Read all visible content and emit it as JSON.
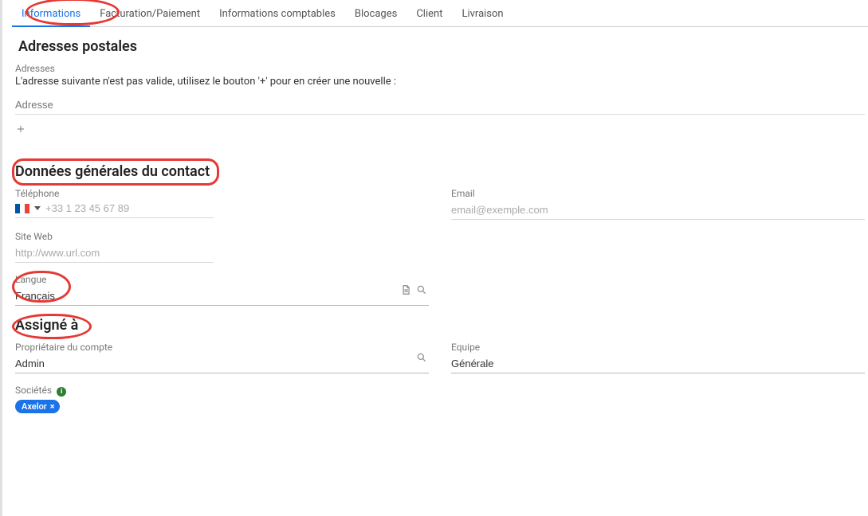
{
  "tabs": [
    {
      "label": "Informations",
      "active": true
    },
    {
      "label": "Facturation/Paiement"
    },
    {
      "label": "Informations comptables"
    },
    {
      "label": "Blocages"
    },
    {
      "label": "Client"
    },
    {
      "label": "Livraison"
    }
  ],
  "addresses": {
    "title": "Adresses postales",
    "label": "Adresses",
    "invalidMsg": "L'adresse suivante n'est pas valide, utilisez le bouton '+' pour en créer une nouvelle :",
    "placeholder": "Adresse"
  },
  "general": {
    "title": "Données générales du contact",
    "phoneLabel": "Téléphone",
    "phonePlaceholder": "+33 1 23 45 67 89",
    "emailLabel": "Email",
    "emailPlaceholder": "email@exemple.com",
    "webLabel": "Site Web",
    "webPlaceholder": "http://www.url.com",
    "langLabel": "Langue",
    "langValue": "Français"
  },
  "assigned": {
    "title": "Assigné à",
    "ownerLabel": "Propriétaire du compte",
    "ownerValue": "Admin",
    "teamLabel": "Equipe",
    "teamValue": "Générale",
    "companiesLabel": "Sociétés",
    "companyTag": "Axelor"
  }
}
